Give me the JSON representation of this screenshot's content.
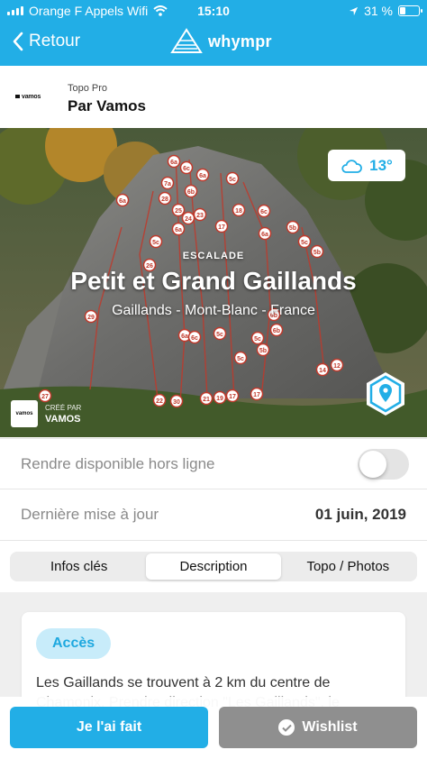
{
  "status_bar": {
    "carrier": "Orange F Appels Wifi",
    "time": "15:10",
    "battery_text": "31 %",
    "battery_level": 0.31
  },
  "nav": {
    "back_label": "Retour",
    "brand": "whympr"
  },
  "author": {
    "logo_text": "vamos",
    "subtitle": "Topo Pro",
    "name": "Par Vamos"
  },
  "hero": {
    "temperature": "13°",
    "category": "ESCALADE",
    "title": "Petit et Grand Gaillands",
    "location": "Gaillands - Mont-Blanc - France",
    "creator_caption": "CRÉÉ PAR",
    "creator_name": "VAMOS",
    "creator_logo_text": "vamos"
  },
  "settings": {
    "offline_label": "Rendre disponible hors ligne",
    "offline_enabled": false,
    "updated_label": "Dernière mise à jour",
    "updated_value": "01 juin, 2019"
  },
  "tabs": [
    {
      "label": "Infos clés",
      "active": false
    },
    {
      "label": "Description",
      "active": true
    },
    {
      "label": "Topo / Photos",
      "active": false
    }
  ],
  "content": {
    "section_pill": "Accès",
    "paragraph": "Les Gaillands se trouvent à 2 km du centre de Chamonix. Prendre direction \"Les Gaillands\", le"
  },
  "actions": {
    "done_label": "Je l'ai fait",
    "wishlist_label": "Wishlist"
  },
  "route_markers": [
    "6a",
    "6c",
    "6a",
    "5c",
    "7a",
    "28",
    "6b",
    "6a",
    "25",
    "24",
    "23",
    "6a",
    "18",
    "6c",
    "17",
    "5b",
    "5c",
    "6a",
    "5c",
    "5b",
    "26",
    "29",
    "6b",
    "6b",
    "5c",
    "5b",
    "5c",
    "6a",
    "6c",
    "5c",
    "14",
    "12",
    "27",
    "22",
    "30",
    "21",
    "19",
    "17",
    "17"
  ],
  "colors": {
    "accent": "#22aee6",
    "wishlist_button": "#8f8f8f",
    "pill_bg": "#c8ecfa"
  }
}
